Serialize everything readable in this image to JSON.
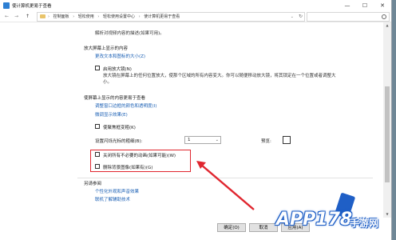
{
  "window": {
    "title": "使计算机更易于查看",
    "controls": {
      "minimize": "—",
      "maximize": "☐",
      "close": "✕"
    }
  },
  "nav": {
    "back": "←",
    "forward": "→",
    "up": "↑",
    "breadcrumbs": [
      "控制面板",
      "轻松使用",
      "轻松使用设置中心",
      "使计算机更易于查看"
    ],
    "separator": "›",
    "dropdown": "⌄",
    "refresh": "↻",
    "search_placeholder": ""
  },
  "content": {
    "intro_line": "解析对视频内容的描述(如果可用)。",
    "magnifier": {
      "heading": "放大屏幕上显示的内容",
      "link_text_size": "更改文本和图标的大小(Z)",
      "checkbox_label": "启用放大镜(N)",
      "description": "放大镜在屏幕上的任何位置放大，使那个区域的所有内容变大。你可以随便移动放大镜，将其锁定在一个位置或者调整大小。"
    },
    "easier_to_see": {
      "heading": "使屏幕上显示的内容更易于查看",
      "link_colors": "调整窗口边框的颜色和透明度(I)",
      "link_fine_tune": "微调显示效果(E)",
      "checkbox_focus": "使聚焦框变粗(K)",
      "cursor_thickness_label": "设置闪烁光标的粗细(B):",
      "cursor_thickness_value": "1",
      "preview_label": "预览:",
      "checkbox_animations": "关闭所有不必要的动画(如果可能)(W)",
      "checkbox_background": "删除背景图像(如果有)(G)"
    },
    "see_also": {
      "heading": "另请参阅",
      "link_personalize": "个性化外观和声音效果",
      "link_more_tech": "联机了解辅助技术"
    }
  },
  "footer": {
    "ok_label": "确定(O)",
    "cancel_label": "取消",
    "apply_label": "应用(A)"
  },
  "watermark": {
    "brand": "APP178",
    "sub": "手游网"
  },
  "colors": {
    "accent": "#e0262f",
    "link": "#1a5fb4",
    "watermark": "#1f5fc6"
  }
}
